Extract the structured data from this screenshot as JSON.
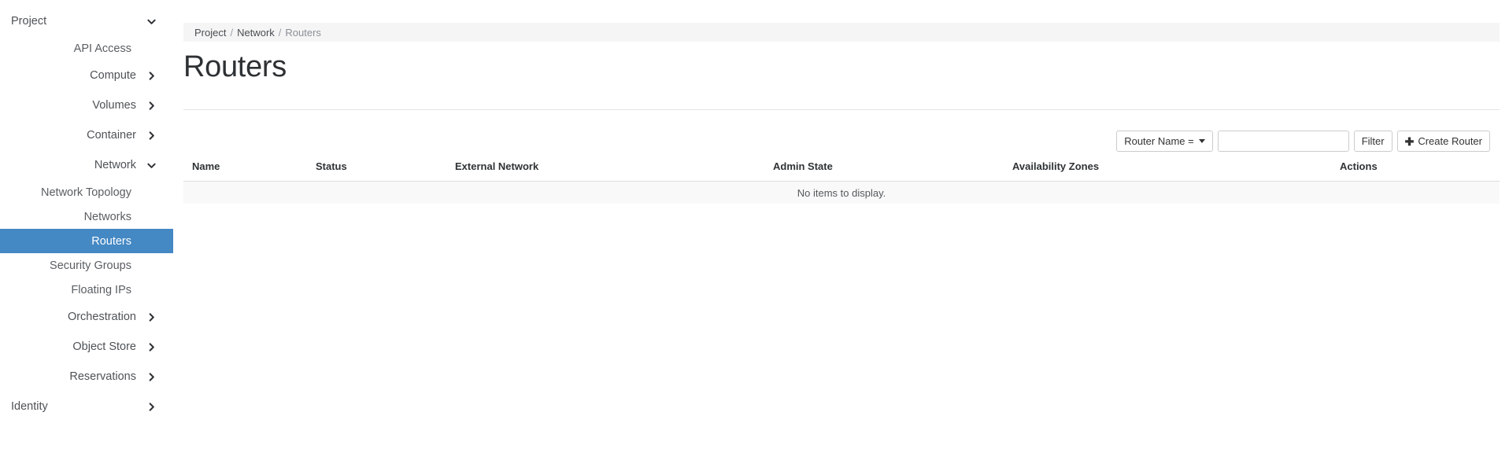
{
  "colors": {
    "accent": "#4488c4",
    "breadcrumb_bg": "#f5f5f5",
    "empty_row_bg": "#f9f9f9",
    "border": "#dddddd"
  },
  "sidebar": {
    "items": [
      {
        "label": "Project",
        "level": "top",
        "icon": "chevron-down-icon",
        "state": "expanded",
        "active": false,
        "name": "sidebar-item-project"
      },
      {
        "label": "API Access",
        "level": "leaf",
        "icon": "",
        "state": "",
        "active": false,
        "name": "sidebar-item-api-access"
      },
      {
        "label": "Compute",
        "level": "group",
        "icon": "chevron-right-icon",
        "state": "collapsed",
        "active": false,
        "name": "sidebar-item-compute"
      },
      {
        "label": "Volumes",
        "level": "group",
        "icon": "chevron-right-icon",
        "state": "collapsed",
        "active": false,
        "name": "sidebar-item-volumes"
      },
      {
        "label": "Container",
        "level": "group",
        "icon": "chevron-right-icon",
        "state": "collapsed",
        "active": false,
        "name": "sidebar-item-container"
      },
      {
        "label": "Network",
        "level": "group",
        "icon": "chevron-down-icon",
        "state": "expanded",
        "active": false,
        "name": "sidebar-item-network"
      },
      {
        "label": "Network Topology",
        "level": "leaf",
        "icon": "",
        "state": "",
        "active": false,
        "name": "sidebar-item-network-topology"
      },
      {
        "label": "Networks",
        "level": "leaf",
        "icon": "",
        "state": "",
        "active": false,
        "name": "sidebar-item-networks"
      },
      {
        "label": "Routers",
        "level": "leaf",
        "icon": "",
        "state": "",
        "active": true,
        "name": "sidebar-item-routers"
      },
      {
        "label": "Security Groups",
        "level": "leaf",
        "icon": "",
        "state": "",
        "active": false,
        "name": "sidebar-item-security-groups"
      },
      {
        "label": "Floating IPs",
        "level": "leaf",
        "icon": "",
        "state": "",
        "active": false,
        "name": "sidebar-item-floating-ips"
      },
      {
        "label": "Orchestration",
        "level": "group",
        "icon": "chevron-right-icon",
        "state": "collapsed",
        "active": false,
        "name": "sidebar-item-orchestration"
      },
      {
        "label": "Object Store",
        "level": "group",
        "icon": "chevron-right-icon",
        "state": "collapsed",
        "active": false,
        "name": "sidebar-item-object-store"
      },
      {
        "label": "Reservations",
        "level": "group",
        "icon": "chevron-right-icon",
        "state": "collapsed",
        "active": false,
        "name": "sidebar-item-reservations"
      },
      {
        "label": "Identity",
        "level": "top",
        "icon": "chevron-right-icon",
        "state": "collapsed",
        "active": false,
        "name": "sidebar-item-identity"
      }
    ]
  },
  "breadcrumb": {
    "items": [
      {
        "label": "Project",
        "current": false
      },
      {
        "label": "Network",
        "current": false
      },
      {
        "label": "Routers",
        "current": true
      }
    ],
    "separator": "/"
  },
  "page": {
    "title": "Routers"
  },
  "toolbar": {
    "filter_field_label": "Router Name =",
    "filter_field_icon": "caret-down-icon",
    "search_value": "",
    "search_placeholder": "",
    "filter_button_label": "Filter",
    "create_button_label": "Create Router",
    "create_button_icon": "plus-icon"
  },
  "table": {
    "columns": [
      {
        "label": "Name",
        "key": "name",
        "class": "col-name"
      },
      {
        "label": "Status",
        "key": "status",
        "class": "col-status"
      },
      {
        "label": "External Network",
        "key": "extnet",
        "class": "col-extnet"
      },
      {
        "label": "Admin State",
        "key": "admin",
        "class": "col-admin"
      },
      {
        "label": "Availability Zones",
        "key": "az",
        "class": "col-az"
      },
      {
        "label": "Actions",
        "key": "actions",
        "class": "col-actions"
      }
    ],
    "rows": [],
    "empty_message": "No items to display."
  }
}
